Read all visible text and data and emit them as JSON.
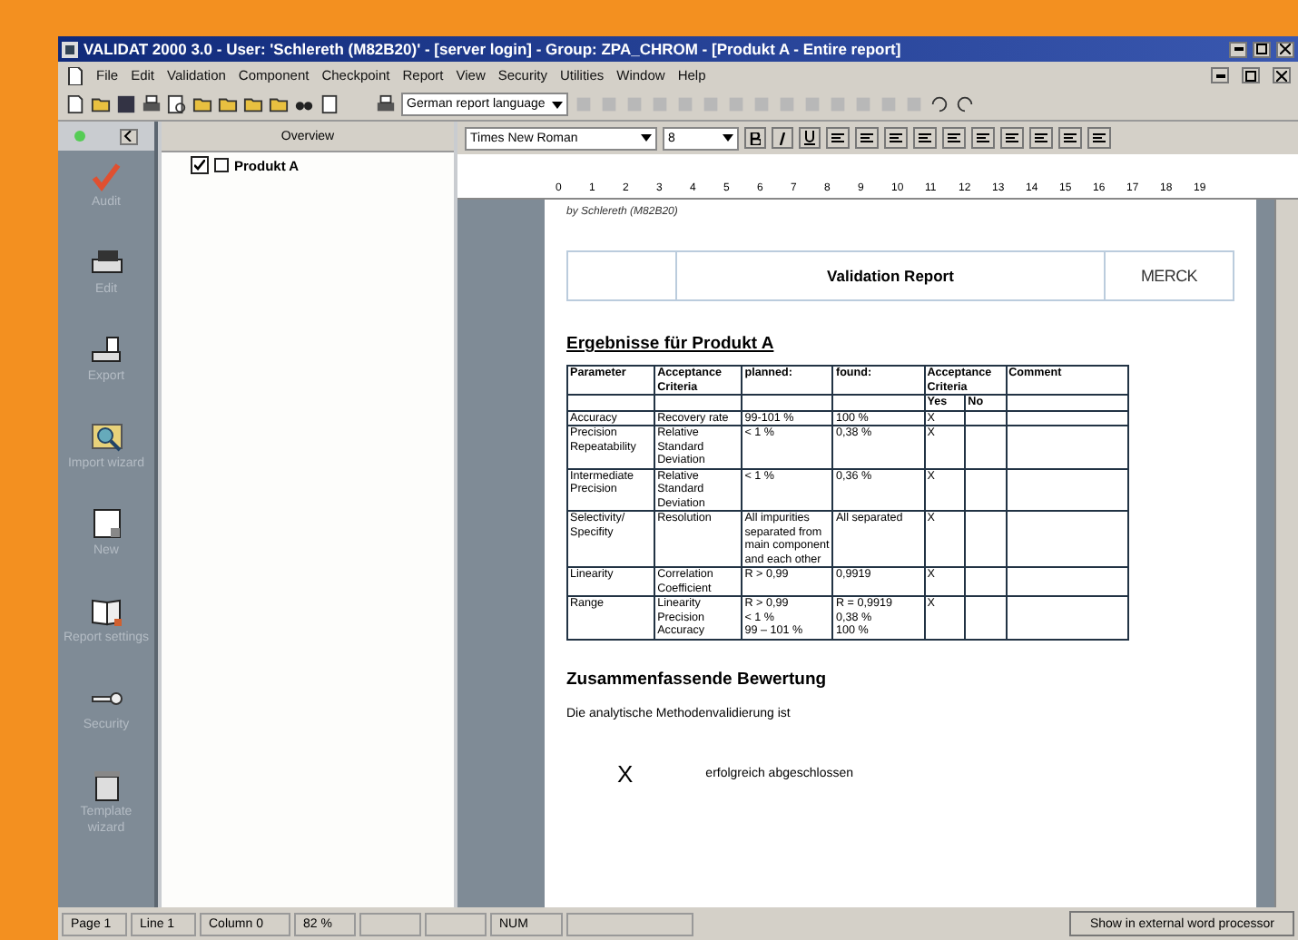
{
  "window": {
    "title": "VALIDAT 2000 3.0 - User: 'Schlereth (M82B20)' - [server login] - Group: ZPA_CHROM - [Produkt A - Entire report]"
  },
  "menu": [
    "File",
    "Edit",
    "Validation",
    "Component",
    "Checkpoint",
    "Report",
    "View",
    "Security",
    "Utilities",
    "Window",
    "Help"
  ],
  "language_select": {
    "value": "German report language"
  },
  "sidebar": {
    "items": [
      {
        "label": "Audit",
        "kind": "check"
      },
      {
        "label": "Edit",
        "kind": "printer"
      },
      {
        "label": "Export",
        "kind": "export"
      },
      {
        "label": "Import wizard",
        "kind": "import"
      },
      {
        "label": "New",
        "kind": "new"
      },
      {
        "label": "Report settings",
        "kind": "book"
      },
      {
        "label": "Security",
        "kind": "key"
      },
      {
        "label": "Template wizard",
        "kind": "template"
      }
    ]
  },
  "overview": {
    "title": "Overview",
    "tree": [
      {
        "label": "Produkt A",
        "checked": true
      }
    ]
  },
  "format_bar": {
    "font": "Times New Roman",
    "size": "8"
  },
  "ruler": [
    "0",
    "1",
    "2",
    "3",
    "4",
    "5",
    "6",
    "7",
    "8",
    "9",
    "10",
    "11",
    "12",
    "13",
    "14",
    "15",
    "16",
    "17",
    "18",
    "19"
  ],
  "document": {
    "path": "by Schlereth (M82B20)",
    "header": "Validation Report",
    "logo": "MERCK",
    "heading": "Ergebnisse für Produkt A",
    "columns": [
      "Parameter",
      "Acceptance Criteria",
      "planned:",
      "found:",
      "Acceptance Criteria",
      "Comment"
    ],
    "subcolumns": [
      "Yes",
      "No"
    ],
    "rows": [
      {
        "parameter": "Accuracy",
        "criteria": "Recovery rate",
        "planned": "99-101 %",
        "found": "100 %",
        "yes": "X"
      },
      {
        "parameter": "Precision Repeatability",
        "criteria": "Relative Standard Deviation",
        "planned": "< 1 %",
        "found": "0,38 %",
        "yes": "X"
      },
      {
        "parameter": "Intermediate Precision",
        "criteria": "Relative Standard Deviation",
        "planned": "< 1 %",
        "found": "0,36 %",
        "yes": "X"
      },
      {
        "parameter": "Selectivity/ Specifity",
        "criteria": "Resolution",
        "planned": "All impurities separated from main component and each other",
        "found": "All separated",
        "yes": "X"
      },
      {
        "parameter": "Linearity",
        "criteria": "Correlation Coefficient",
        "planned": "R > 0,99",
        "found": "0,9919",
        "yes": "X"
      },
      {
        "parameter": "Range",
        "criteria": "Linearity\nPrecision\nAccuracy",
        "planned": "R > 0,99\n< 1 %\n99 – 101 %",
        "found": "R = 0,9919\n0,38 %\n100 %",
        "yes": "X"
      }
    ],
    "summary_heading": "Zusammenfassende Bewertung",
    "summary_text": "Die analytische  Methodenvalidierung ist",
    "result_mark": "X",
    "result_text": "erfolgreich abgeschlossen"
  },
  "status_bar": {
    "fields": [
      "Page  1",
      "Line  1",
      "Column  0",
      "82 %",
      "NUM"
    ],
    "button": "Show in external word processor"
  }
}
